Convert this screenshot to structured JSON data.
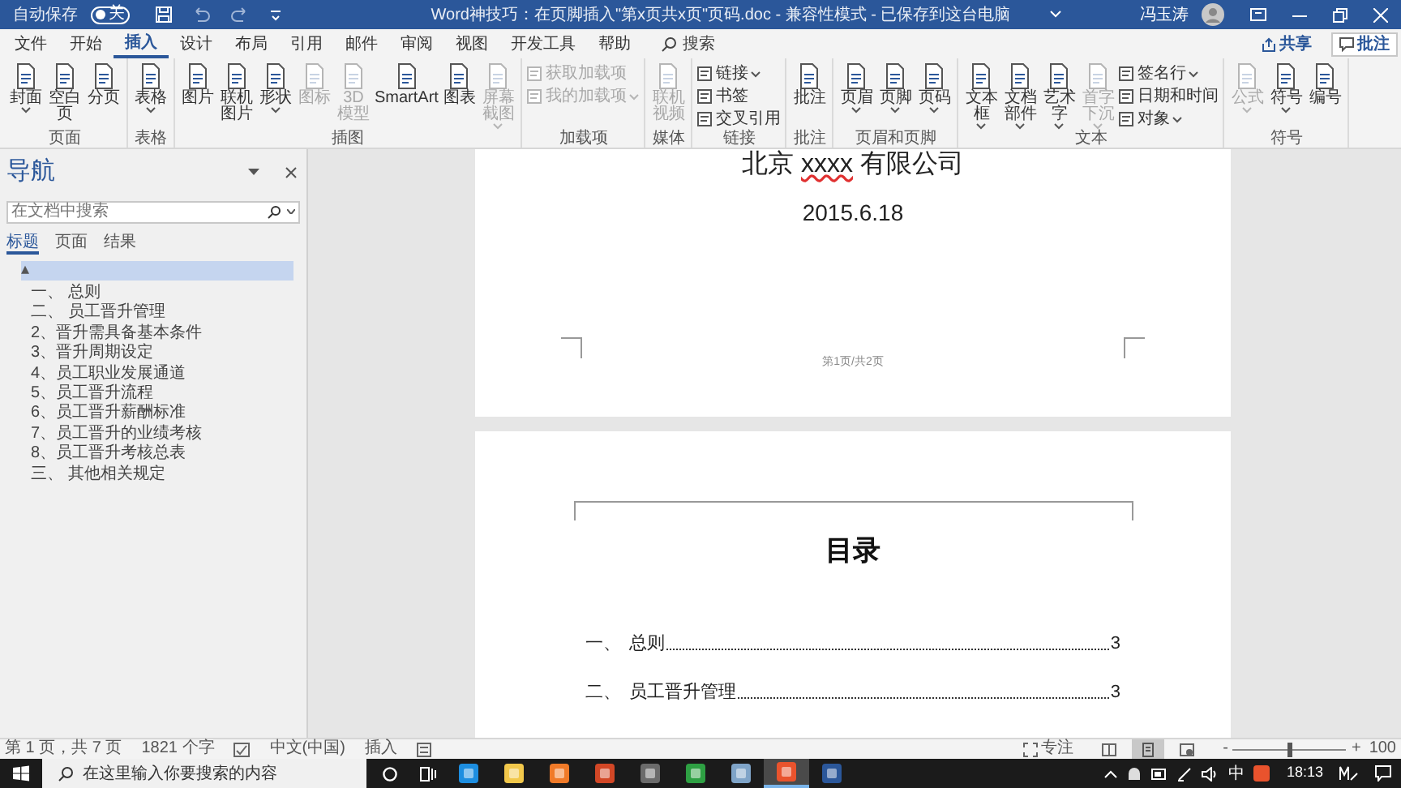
{
  "title_bar": {
    "autosave_label": "自动保存",
    "autosave_on": false,
    "autosave_state": "关",
    "title": "Word神技巧：在页脚插入\"第x页共x页\"页码.doc  -  兼容性模式  -  已保存到这台电脑",
    "user": "冯玉涛"
  },
  "ribbon_tabs": [
    {
      "label": "文件",
      "selected": false
    },
    {
      "label": "开始",
      "selected": false
    },
    {
      "label": "插入",
      "selected": true
    },
    {
      "label": "设计",
      "selected": false
    },
    {
      "label": "布局",
      "selected": false
    },
    {
      "label": "引用",
      "selected": false
    },
    {
      "label": "邮件",
      "selected": false
    },
    {
      "label": "审阅",
      "selected": false
    },
    {
      "label": "视图",
      "selected": false
    },
    {
      "label": "开发工具",
      "selected": false
    },
    {
      "label": "帮助",
      "selected": false
    }
  ],
  "tell_me": {
    "placeholder": "搜索"
  },
  "share_button": "共享",
  "comments_button": "批注",
  "ribbon_groups": [
    {
      "label": "页面",
      "items": [
        {
          "kind": "large",
          "label": "封面",
          "dropdown": true,
          "disabled": false
        },
        {
          "kind": "large",
          "label": "空白页",
          "dropdown": false,
          "disabled": false
        },
        {
          "kind": "large",
          "label": "分页",
          "dropdown": false,
          "disabled": false
        }
      ]
    },
    {
      "label": "表格",
      "items": [
        {
          "kind": "large",
          "label": "表格",
          "dropdown": true,
          "disabled": false
        }
      ]
    },
    {
      "label": "插图",
      "items": [
        {
          "kind": "large",
          "label": "图片",
          "dropdown": false,
          "disabled": false
        },
        {
          "kind": "large",
          "label": "联机图片",
          "dropdown": false,
          "disabled": false
        },
        {
          "kind": "large",
          "label": "形状",
          "dropdown": true,
          "disabled": false
        },
        {
          "kind": "large",
          "label": "图标",
          "dropdown": false,
          "disabled": true
        },
        {
          "kind": "large",
          "label": "3D 模型",
          "dropdown": false,
          "disabled": true
        },
        {
          "kind": "large",
          "label": "SmartArt",
          "dropdown": false,
          "disabled": false
        },
        {
          "kind": "large",
          "label": "图表",
          "dropdown": false,
          "disabled": false
        },
        {
          "kind": "large",
          "label": "屏幕截图",
          "dropdown": true,
          "disabled": true
        }
      ]
    },
    {
      "label": "加载项",
      "items": [
        {
          "kind": "small",
          "label": "获取加载项",
          "dropdown": false,
          "disabled": true
        },
        {
          "kind": "small",
          "label": "我的加载项",
          "dropdown": true,
          "disabled": true
        }
      ]
    },
    {
      "label": "媒体",
      "items": [
        {
          "kind": "large",
          "label": "联机视频",
          "dropdown": false,
          "disabled": true
        }
      ]
    },
    {
      "label": "链接",
      "items": [
        {
          "kind": "small",
          "label": "链接",
          "dropdown": true,
          "disabled": false
        },
        {
          "kind": "small",
          "label": "书签",
          "dropdown": false,
          "disabled": false
        },
        {
          "kind": "small",
          "label": "交叉引用",
          "dropdown": false,
          "disabled": false
        }
      ]
    },
    {
      "label": "批注",
      "items": [
        {
          "kind": "large",
          "label": "批注",
          "dropdown": false,
          "disabled": false
        }
      ]
    },
    {
      "label": "页眉和页脚",
      "items": [
        {
          "kind": "large",
          "label": "页眉",
          "dropdown": true,
          "disabled": false
        },
        {
          "kind": "large",
          "label": "页脚",
          "dropdown": true,
          "disabled": false
        },
        {
          "kind": "large",
          "label": "页码",
          "dropdown": true,
          "disabled": false
        }
      ]
    },
    {
      "label": "文本",
      "items": [
        {
          "kind": "large",
          "label": "文本框",
          "dropdown": true,
          "disabled": false
        },
        {
          "kind": "large",
          "label": "文档部件",
          "dropdown": true,
          "disabled": false
        },
        {
          "kind": "large",
          "label": "艺术字",
          "dropdown": true,
          "disabled": false
        },
        {
          "kind": "large",
          "label": "首字下沉",
          "dropdown": true,
          "disabled": true
        },
        {
          "kind": "small",
          "label": "签名行",
          "dropdown": true,
          "disabled": false
        },
        {
          "kind": "small",
          "label": "日期和时间",
          "dropdown": false,
          "disabled": false
        },
        {
          "kind": "small",
          "label": "对象",
          "dropdown": true,
          "disabled": false
        }
      ]
    },
    {
      "label": "符号",
      "items": [
        {
          "kind": "large",
          "label": "公式",
          "dropdown": true,
          "disabled": true
        },
        {
          "kind": "large",
          "label": "符号",
          "dropdown": true,
          "disabled": false
        },
        {
          "kind": "large",
          "label": "编号",
          "dropdown": false,
          "disabled": false
        }
      ]
    }
  ],
  "navigation": {
    "title": "导航",
    "search": {
      "placeholder": "在文档中搜索"
    },
    "tabs": [
      {
        "label": "标题",
        "selected": true
      },
      {
        "label": "页面",
        "selected": false
      },
      {
        "label": "结果",
        "selected": false
      }
    ],
    "headings": [
      {
        "label": "▴",
        "selected": true
      },
      {
        "label": "一、 总则",
        "selected": false
      },
      {
        "label": "二、 员工晋升管理",
        "selected": false
      },
      {
        "label": "2、晋升需具备基本条件",
        "selected": false
      },
      {
        "label": "3、晋升周期设定",
        "selected": false
      },
      {
        "label": "4、员工职业发展通道",
        "selected": false
      },
      {
        "label": "5、员工晋升流程",
        "selected": false
      },
      {
        "label": "6、员工晋升薪酬标准",
        "selected": false
      },
      {
        "label": "7、员工晋升的业绩考核",
        "selected": false
      },
      {
        "label": "8、员工晋升考核总表",
        "selected": false
      },
      {
        "label": "三、 其他相关规定",
        "selected": false
      }
    ]
  },
  "document": {
    "page_1": {
      "company": {
        "before": "北京 ",
        "flagged": "xxxx",
        "after": " 有限公司"
      },
      "date": "2015.6.18",
      "footer": "第1页/共2页"
    },
    "page_2": {
      "heading": "目录",
      "toc": [
        {
          "number": "一、",
          "title": "总则",
          "page": "3"
        },
        {
          "number": "二、",
          "title": "员工晋升管理",
          "page": "3"
        }
      ]
    }
  },
  "status_bar": {
    "page": "第 1 页，共 7 页",
    "words": "1821 个字",
    "language": "中文(中国)",
    "mode": "插入",
    "focus": "专注",
    "views": [
      {
        "kind": "read",
        "selected": false
      },
      {
        "kind": "print",
        "selected": true
      },
      {
        "kind": "web",
        "selected": false
      }
    ],
    "zoom": {
      "level": 0.5,
      "minus": "-",
      "plus": "+",
      "reading": "100"
    }
  },
  "taskbar": {
    "search_placeholder": "在这里输入你要搜索的内容",
    "apps": [
      {
        "kind": "edge",
        "selected": false
      },
      {
        "kind": "explorer",
        "selected": false
      },
      {
        "kind": "firefox",
        "selected": false
      },
      {
        "kind": "powerpoint",
        "selected": false
      },
      {
        "kind": "mindmap",
        "selected": false
      },
      {
        "kind": "green",
        "selected": false
      },
      {
        "kind": "notes",
        "selected": false
      },
      {
        "kind": "orange",
        "selected": true
      },
      {
        "kind": "word",
        "selected": false
      }
    ],
    "ime": "中",
    "time": "18:13"
  }
}
